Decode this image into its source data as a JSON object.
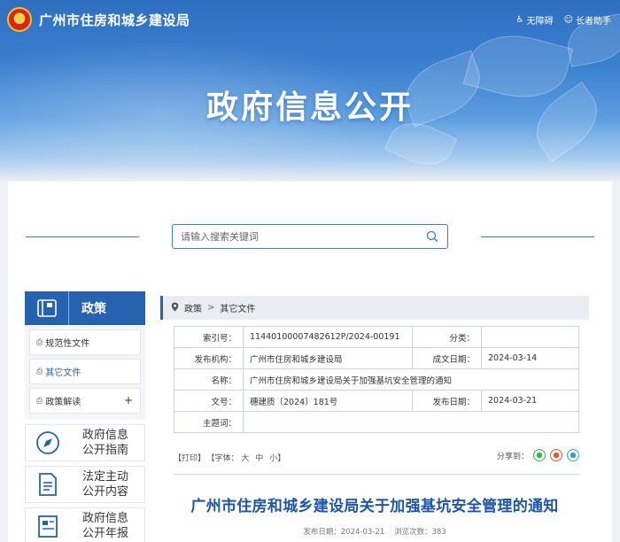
{
  "header": {
    "site_name": "广州市住房和城乡建设局",
    "tools": {
      "accessibility": "无障碍",
      "elderly": "长者助手"
    },
    "banner_title": "政府信息公开"
  },
  "search": {
    "placeholder": "请输入搜索关键词"
  },
  "sidebar": {
    "section_title": "政策",
    "items": [
      {
        "label": "规范性文件"
      },
      {
        "label": "其它文件"
      },
      {
        "label": "政策解读",
        "expand": "+"
      }
    ],
    "quick_links": [
      {
        "line1": "政府信息",
        "line2": "公开指南",
        "icon": "compass-icon"
      },
      {
        "line1": "法定主动",
        "line2": "公开内容",
        "icon": "document-icon"
      },
      {
        "line1": "政府信息",
        "line2": "公开年报",
        "icon": "report-icon"
      }
    ]
  },
  "breadcrumb": {
    "items": [
      "政策",
      "其它文件"
    ],
    "separator": ">"
  },
  "meta": {
    "index_label": "索引号：",
    "index_value": "11440100007482612P/2024-00191",
    "category_label": "分类：",
    "category_value": "",
    "publisher_label": "发布机构：",
    "publisher_value": "广州市住房和城乡建设局",
    "created_label": "成文日期：",
    "created_value": "2024-03-14",
    "name_label": "名称：",
    "name_value": "广州市住房和城乡建设局关于加强基坑安全管理的通知",
    "docno_label": "文号：",
    "docno_value": "穗建质〔2024〕181号",
    "published_label": "发布日期：",
    "published_value": "2024-03-21",
    "keywords_label": "主题词：",
    "keywords_value": ""
  },
  "doc_tools": {
    "print": "【打印】",
    "font_size": "【字体：",
    "large": "大",
    "medium": "中",
    "small": "小",
    "close_bracket": "】",
    "share_label": "分享到："
  },
  "document": {
    "title": "广州市住房和城乡建设局关于加强基坑安全管理的通知",
    "publish_date": "发布日期：2024-03-21",
    "views": "浏览次数：383"
  },
  "colors": {
    "primary": "#2563b0",
    "title": "#1d55a8",
    "wechat": "#3bb54a",
    "weibo": "#e4572e",
    "qzone": "#3a9ad9"
  }
}
